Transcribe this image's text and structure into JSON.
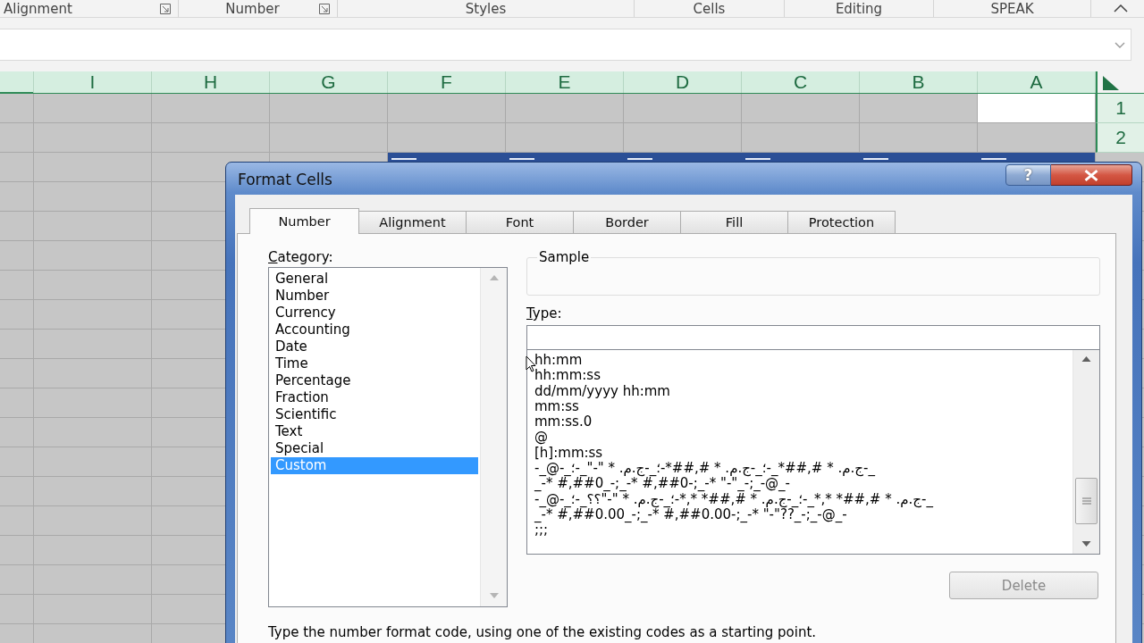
{
  "ribbon": {
    "groups": [
      {
        "label": "Alignment",
        "launcher": true
      },
      {
        "label": "Number",
        "launcher": true
      },
      {
        "label": "Styles",
        "launcher": false
      },
      {
        "label": "Cells",
        "launcher": false
      },
      {
        "label": "Editing",
        "launcher": false
      },
      {
        "label": "SPEAK",
        "launcher": false
      }
    ]
  },
  "sheet": {
    "columns": [
      {
        "label": "I",
        "selected": true,
        "active": false
      },
      {
        "label": "H",
        "selected": true,
        "active": false
      },
      {
        "label": "G",
        "selected": true,
        "active": false
      },
      {
        "label": "F",
        "selected": true,
        "active": false
      },
      {
        "label": "E",
        "selected": true,
        "active": false
      },
      {
        "label": "D",
        "selected": true,
        "active": false
      },
      {
        "label": "C",
        "selected": true,
        "active": false
      },
      {
        "label": "B",
        "selected": true,
        "active": false
      },
      {
        "label": "A",
        "selected": true,
        "active": true
      }
    ],
    "rows": [
      {
        "header": "1",
        "selected": true,
        "active": true
      },
      {
        "header": "2",
        "selected": true,
        "active": false
      }
    ]
  },
  "dialog": {
    "title": "Format Cells",
    "help_button": "?",
    "tabs": [
      {
        "label": "Number",
        "selected": true
      },
      {
        "label": "Alignment",
        "selected": false
      },
      {
        "label": "Font",
        "selected": false
      },
      {
        "label": "Border",
        "selected": false
      },
      {
        "label": "Fill",
        "selected": false
      },
      {
        "label": "Protection",
        "selected": false
      }
    ],
    "category": {
      "label": "Category:",
      "items": [
        {
          "label": "General",
          "selected": false
        },
        {
          "label": "Number",
          "selected": false
        },
        {
          "label": "Currency",
          "selected": false
        },
        {
          "label": "Accounting",
          "selected": false
        },
        {
          "label": "Date",
          "selected": false
        },
        {
          "label": "Time",
          "selected": false
        },
        {
          "label": "Percentage",
          "selected": false
        },
        {
          "label": "Fraction",
          "selected": false
        },
        {
          "label": "Scientific",
          "selected": false
        },
        {
          "label": "Text",
          "selected": false
        },
        {
          "label": "Special",
          "selected": false
        },
        {
          "label": "Custom",
          "selected": true
        }
      ]
    },
    "sample": {
      "label": "Sample"
    },
    "type": {
      "label": "Type:",
      "items": [
        "hh:mm",
        "hh:mm:ss",
        "dd/mm/yyyy hh:mm",
        "mm:ss",
        "mm:ss.0",
        "@",
        "[h]:mm:ss",
        "-_@-_؛-_\"-\" * .م.ج-_؛-*##,# * .م.ج-_؛-_*##,# * .م.ج-_",
        "_-* #,##0_-;_-* #,##0-;_-* \"-\"_-;_-@_-",
        "-_@-_؛-_؟؟\"-\" * .م.ج-_؛-*,* *##,# * .م.ج-_؛-_*,* *##,# * .م.ج-_",
        "_-* #,##0.00_-;_-* #,##0.00-;_-* \"-\"??_-;_-@_-",
        ";;;"
      ]
    },
    "delete_button": {
      "label": "Delete",
      "disabled": true
    },
    "hint": "Type the number format code, using one of the existing codes as a starting point."
  }
}
